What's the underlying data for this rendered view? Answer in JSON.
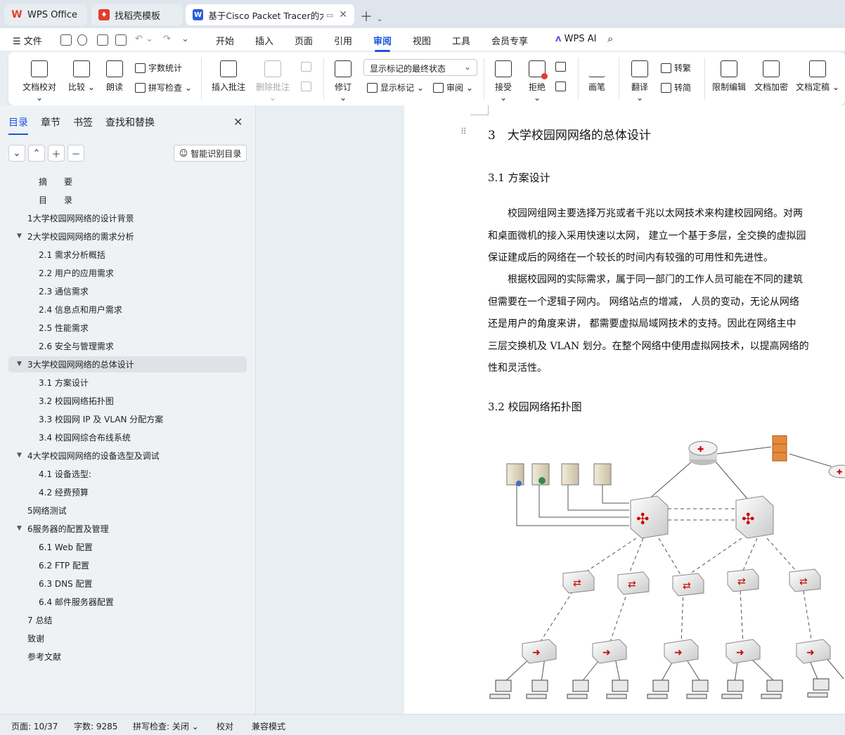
{
  "tabs": [
    {
      "label": "WPS Office",
      "icon": "wps-logo-icon",
      "color": "#e23d2e"
    },
    {
      "label": "找稻壳模板",
      "icon": "docer-icon",
      "color": "#e23d2e"
    },
    {
      "label": "基于Cisco Packet Tracer的大",
      "icon": "word-doc-icon",
      "color": "#2b5fd9"
    }
  ],
  "menu": {
    "file": "文件",
    "items": [
      "开始",
      "插入",
      "页面",
      "引用",
      "审阅",
      "视图",
      "工具",
      "会员专享"
    ],
    "active": "审阅",
    "wps_ai": "WPS AI"
  },
  "ribbon": {
    "doc_check": "文档校对",
    "compare": "比较",
    "read_aloud": "朗读",
    "word_count": "字数统计",
    "spell_check": "拼写检查",
    "insert_comment": "插入批注",
    "delete_comment": "删除批注",
    "revise": "修订",
    "markup_state": "显示标记的最终状态",
    "show_markup": "显示标记",
    "review": "审阅",
    "accept": "接受",
    "reject": "拒绝",
    "pen": "画笔",
    "translate": "翻译",
    "to_trad": "转繁",
    "to_simp": "转简",
    "restrict_edit": "限制编辑",
    "encrypt": "文档加密",
    "finalize": "文档定稿"
  },
  "panel": {
    "tabs": [
      "目录",
      "章节",
      "书签",
      "查找和替换"
    ],
    "smart_toc": "智能识别目录",
    "toc": [
      {
        "label": "摘　　要",
        "level": 2
      },
      {
        "label": "目　　录",
        "level": 2
      },
      {
        "label": "1大学校园网网络的设计背景",
        "level": 1
      },
      {
        "label": "2大学校园网网络的需求分析",
        "level": 1,
        "expanded": true
      },
      {
        "label": "2.1  需求分析概括",
        "level": 2
      },
      {
        "label": "2.2  用户的应用需求",
        "level": 2
      },
      {
        "label": "2.3  通信需求",
        "level": 2
      },
      {
        "label": "2.4  信息点和用户需求",
        "level": 2
      },
      {
        "label": "2.5  性能需求",
        "level": 2
      },
      {
        "label": "2.6  安全与管理需求",
        "level": 2
      },
      {
        "label": "3大学校园网网络的总体设计",
        "level": 1,
        "expanded": true,
        "selected": true
      },
      {
        "label": "3.1  方案设计",
        "level": 2
      },
      {
        "label": "3.2  校园网络拓扑图",
        "level": 2
      },
      {
        "label": "3.3  校园网 IP 及 VLAN 分配方案",
        "level": 2
      },
      {
        "label": "3.4  校园网综合布线系统",
        "level": 2
      },
      {
        "label": "4大学校园网网络的设备选型及调试",
        "level": 1,
        "expanded": true
      },
      {
        "label": "4.1  设备选型:",
        "level": 2
      },
      {
        "label": "4.2  经费预算",
        "level": 2
      },
      {
        "label": "5网络测试",
        "level": 1
      },
      {
        "label": "6服务器的配置及管理",
        "level": 1,
        "expanded": true
      },
      {
        "label": "6.1 Web 配置",
        "level": 2
      },
      {
        "label": "6.2 FTP 配置",
        "level": 2
      },
      {
        "label": "6.3 DNS 配置",
        "level": 2
      },
      {
        "label": "6.4 邮件服务器配置",
        "level": 2
      },
      {
        "label": "7 总结",
        "level": 1
      },
      {
        "label": "致谢",
        "level": 1
      },
      {
        "label": "参考文献",
        "level": 1
      }
    ]
  },
  "document": {
    "heading": "3　大学校园网网络的总体设计",
    "section1": "3.1  方案设计",
    "para1": [
      "　　校园网组网主要选择万兆或者千兆以太网技术来构建校园网络。对两",
      "和桌面微机的接入采用快速以太网， 建立一个基于多层，全交换的虚拟园",
      "保证建成后的网络在一个较长的时间内有较强的可用性和先进性。"
    ],
    "para2": [
      "　　根据校园网的实际需求，属于同一部门的工作人员可能在不同的建筑",
      "但需要在一个逻辑子网内。 网络站点的增减， 人员的变动，无论从网络",
      "还是用户的角度来讲， 都需要虚拟局域网技术的支持。因此在网络主中",
      "三层交换机及  VLAN  划分。在整个网络中使用虚拟网技术，以提高网络的",
      "性和灵活性。"
    ],
    "section2": "3.2  校园网络拓扑图"
  },
  "status": {
    "page": "页面: 10/37",
    "words": "字数: 9285",
    "spell": "拼写检查: 关闭",
    "proof": "校对",
    "compat": "兼容模式"
  }
}
